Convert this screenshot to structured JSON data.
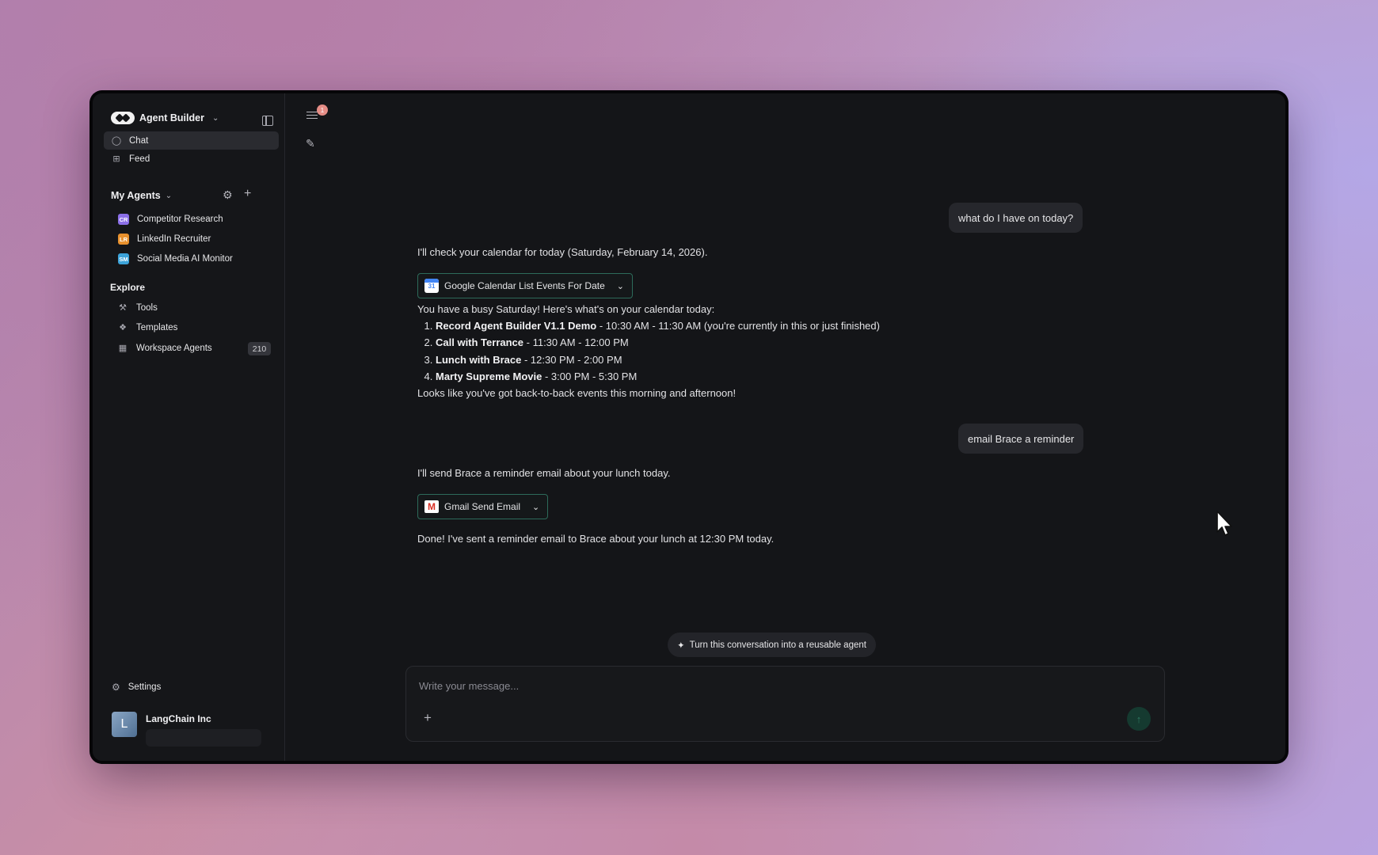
{
  "sidebar": {
    "brand": "Agent Builder",
    "nav": [
      {
        "label": "Chat",
        "icon": "chat-icon"
      },
      {
        "label": "Feed",
        "icon": "feed-icon"
      }
    ],
    "my_agents_title": "My Agents",
    "agents": [
      {
        "abbr": "CR",
        "label": "Competitor Research",
        "color": "#8b6fe8"
      },
      {
        "abbr": "LR",
        "label": "LinkedIn Recruiter",
        "color": "#e8912e"
      },
      {
        "abbr": "SM",
        "label": "Social Media AI Monitor",
        "color": "#3ca3d9"
      }
    ],
    "explore_title": "Explore",
    "explore": [
      {
        "label": "Tools",
        "icon": "wrench-icon"
      },
      {
        "label": "Templates",
        "icon": "templates-icon"
      },
      {
        "label": "Workspace Agents",
        "icon": "building-icon"
      }
    ],
    "workspace_agents_count": "210",
    "settings_label": "Settings",
    "org": {
      "initial": "L",
      "name": "LangChain Inc"
    }
  },
  "header": {
    "notification_count": "1"
  },
  "conversation": {
    "user_msg_1": "what do I have on today?",
    "ai_msg_1": "I'll check your calendar for today (Saturday, February 14, 2026).",
    "tool_1": "Google Calendar List Events For Date",
    "events_intro": "You have a busy Saturday! Here's what's on your calendar today:",
    "events": [
      {
        "title": "Record Agent Builder V1.1 Demo",
        "time": " - 10:30 AM - 11:30 AM (you're currently in this or just finished)"
      },
      {
        "title": "Call with Terrance",
        "time": " - 11:30 AM - 12:00 PM"
      },
      {
        "title": "Lunch with Brace",
        "time": " - 12:30 PM - 2:00 PM"
      },
      {
        "title": "Marty Supreme Movie",
        "time": " - 3:00 PM - 5:30 PM"
      }
    ],
    "events_outro": "Looks like you've got back-to-back events this morning and afternoon!",
    "user_msg_2": "email Brace a reminder",
    "ai_msg_2": "I'll send Brace a reminder email about your lunch today.",
    "tool_2": "Gmail Send Email",
    "ai_msg_3": "Done! I've sent a reminder email to Brace about your lunch at 12:30 PM today."
  },
  "turn_into_agent": "Turn this conversation into a reusable agent",
  "composer": {
    "placeholder": "Write your message..."
  },
  "colors": {
    "tool_border": "#2d6b5a",
    "send_button": "#153a30",
    "notification": "#e58d86"
  }
}
